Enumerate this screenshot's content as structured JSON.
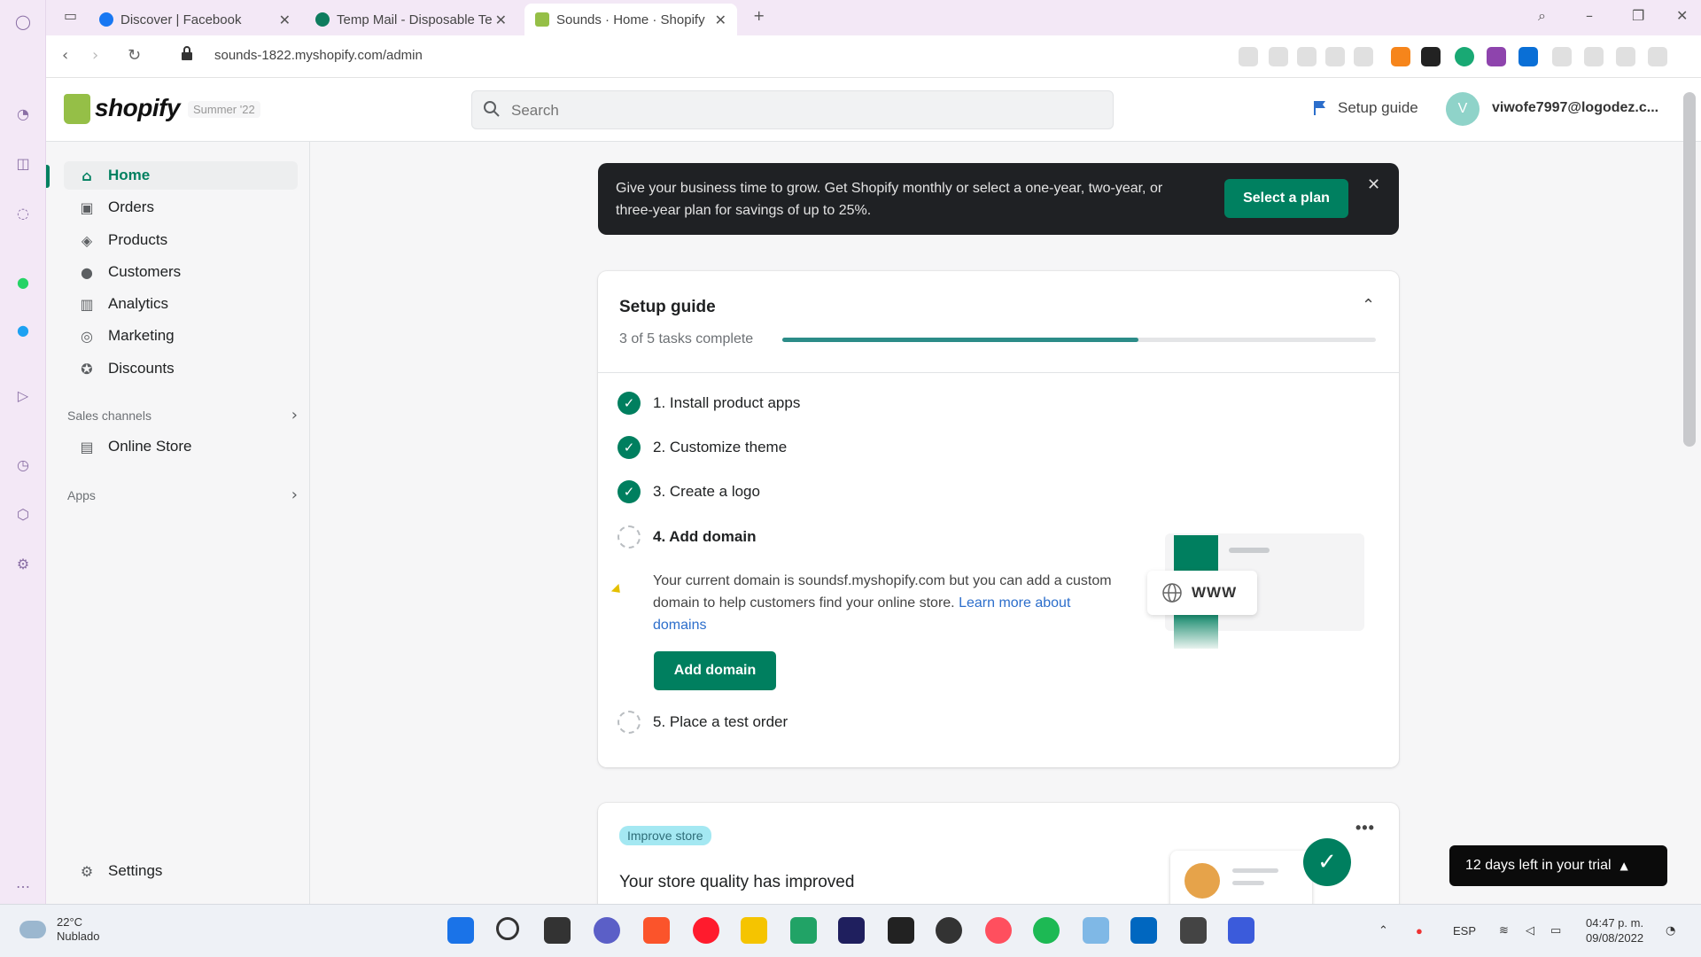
{
  "browser": {
    "tabs": [
      {
        "label": "Discover | Facebook",
        "color": "#1877f2"
      },
      {
        "label": "Temp Mail - Disposable Te",
        "color": "#0e7c5e"
      },
      {
        "label": "Sounds · Home · Shopify",
        "color": "#95bf47"
      }
    ],
    "url": "sounds-1822.myshopify.com/admin"
  },
  "shopify": {
    "logo_text": "shopify",
    "edition": "Summer '22",
    "search_placeholder": "Search",
    "setup_guide_link": "Setup guide",
    "avatar_initial": "V",
    "account_email": "viwofe7997@logodez.c..."
  },
  "nav": {
    "items": [
      {
        "label": "Home",
        "icon": "home-icon"
      },
      {
        "label": "Orders",
        "icon": "orders-icon"
      },
      {
        "label": "Products",
        "icon": "tag-icon"
      },
      {
        "label": "Customers",
        "icon": "person-icon"
      },
      {
        "label": "Analytics",
        "icon": "bar-chart-icon"
      },
      {
        "label": "Marketing",
        "icon": "target-icon"
      },
      {
        "label": "Discounts",
        "icon": "discount-icon"
      }
    ],
    "sales_channels": "Sales channels",
    "online_store": "Online Store",
    "apps": "Apps",
    "settings": "Settings"
  },
  "banner": {
    "text": "Give your business time to grow. Get Shopify monthly or select a one-year, two-year, or three-year plan for savings of up to 25%.",
    "button": "Select a plan"
  },
  "setup": {
    "title": "Setup guide",
    "progress_text": "3 of 5 tasks complete",
    "progress_fraction": 0.6,
    "tasks": [
      {
        "label": "1. Install product apps",
        "done": true
      },
      {
        "label": "2. Customize theme",
        "done": true
      },
      {
        "label": "3. Create a logo",
        "done": true
      },
      {
        "label": "4. Add domain",
        "done": false
      },
      {
        "label": "5. Place a test order",
        "done": false
      }
    ],
    "domain_desc": "Your current domain is soundsf.myshopify.com but you can add a custom domain to help customers find your online store.",
    "learn_more": "Learn more about domains",
    "add_domain_button": "Add domain",
    "illustration_text": "WWW"
  },
  "quality": {
    "badge": "Improve store",
    "title": "Your store quality has improved"
  },
  "trial": {
    "text": "12 days left in your trial"
  },
  "taskbar": {
    "temp": "22°C",
    "weather": "Nublado",
    "lang": "ESP",
    "time": "04:47 p. m.",
    "date": "09/08/2022"
  },
  "colors": {
    "brand_green": "#008060",
    "progress": "#2c8c88",
    "banner_bg": "#1f2124"
  }
}
